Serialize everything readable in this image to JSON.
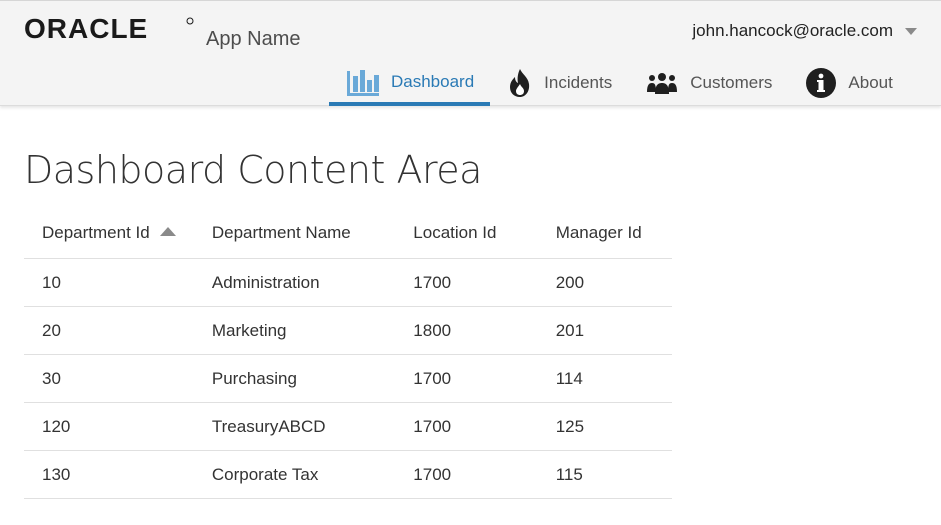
{
  "brand": {
    "logo_text": "ORACLE",
    "app_name": "App Name"
  },
  "user": {
    "email": "john.hancock@oracle.com",
    "menu_icon": "caret-down-icon"
  },
  "nav": {
    "items": [
      {
        "label": "Dashboard",
        "icon": "bar-chart-icon",
        "active": true
      },
      {
        "label": "Incidents",
        "icon": "fire-icon",
        "active": false
      },
      {
        "label": "Customers",
        "icon": "people-icon",
        "active": false
      },
      {
        "label": "About",
        "icon": "info-icon",
        "active": false
      }
    ]
  },
  "colors": {
    "accent": "#2a7ab5",
    "header_bg": "#f4f4f4"
  },
  "main": {
    "title": "Dashboard Content Area",
    "table": {
      "sorted_column": "Department Id",
      "sort_direction": "ascending",
      "columns": [
        "Department Id",
        "Department Name",
        "Location Id",
        "Manager Id"
      ],
      "rows": [
        [
          "10",
          "Administration",
          "1700",
          "200"
        ],
        [
          "20",
          "Marketing",
          "1800",
          "201"
        ],
        [
          "30",
          "Purchasing",
          "1700",
          "114"
        ],
        [
          "120",
          "TreasuryABCD",
          "1700",
          "125"
        ],
        [
          "130",
          "Corporate Tax",
          "1700",
          "115"
        ]
      ]
    }
  }
}
